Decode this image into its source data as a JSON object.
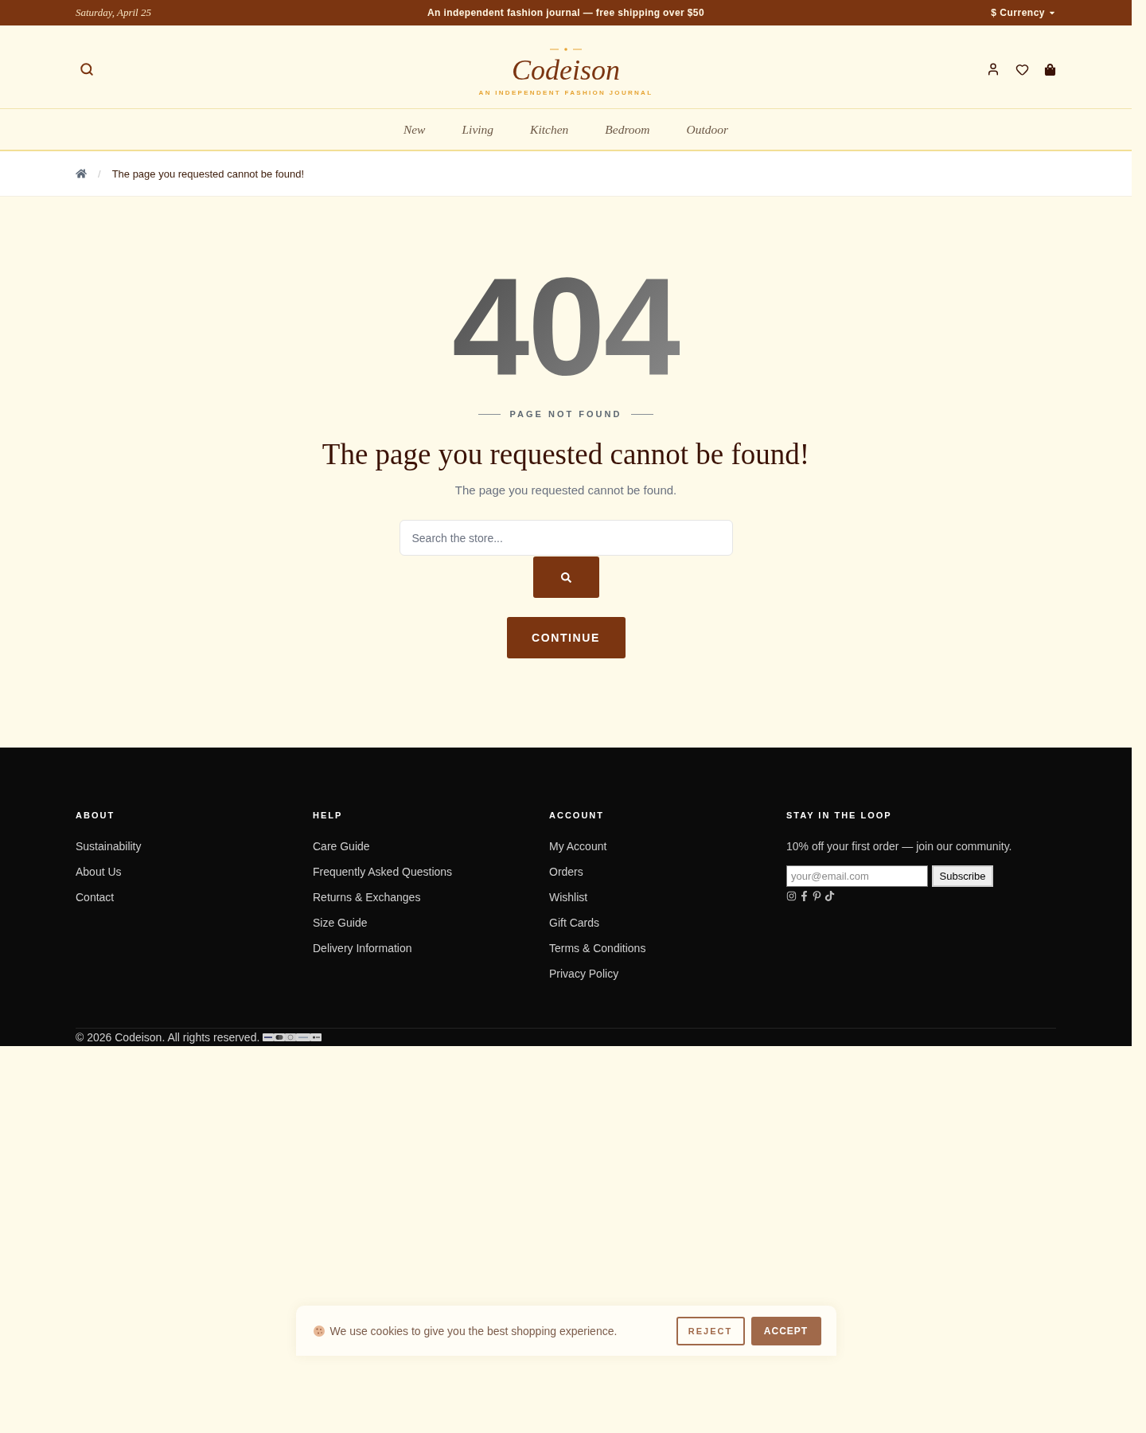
{
  "top_bar": {
    "date": "Saturday, April 25",
    "announcement": "An independent fashion journal — free shipping over $50",
    "currency": "$ Currency"
  },
  "header": {
    "logo": "Codeison",
    "tagline": "AN INDEPENDENT FASHION JOURNAL"
  },
  "nav": [
    "New",
    "Living",
    "Kitchen",
    "Bedroom",
    "Outdoor"
  ],
  "breadcrumb": {
    "separator": "/",
    "current": "The page you requested cannot be found!"
  },
  "error": {
    "code": "404",
    "eyebrow": "PAGE NOT FOUND",
    "title": "The page you requested cannot be found!",
    "message": "The page you requested cannot be found.",
    "search": {
      "placeholder": "Search the store..."
    },
    "continue": "CONTINUE"
  },
  "footer": {
    "columns": [
      {
        "heading": "ABOUT",
        "links": [
          "Sustainability",
          "About Us",
          "Contact"
        ]
      },
      {
        "heading": "HELP",
        "links": [
          "Care Guide",
          "Frequently Asked Questions",
          "Returns & Exchanges",
          "Size Guide",
          "Delivery Information"
        ]
      },
      {
        "heading": "ACCOUNT",
        "links": [
          "My Account",
          "Orders",
          "Wishlist",
          "Gift Cards",
          "Terms & Conditions",
          "Privacy Policy"
        ]
      }
    ],
    "newsletter": {
      "heading": "STAY IN THE LOOP",
      "text": "10% off your first order — join our community.",
      "email": {
        "placeholder": "your@email.com"
      },
      "button": "Subscribe"
    },
    "copyright": "© 2026 Codeison. All rights reserved."
  },
  "cookie_banner": {
    "message": "We use cookies to give you the best shopping experience.",
    "buttons": [
      {
        "kind": "reject",
        "label": "REJECT"
      },
      {
        "kind": "accept",
        "label": "ACCEPT"
      }
    ]
  }
}
